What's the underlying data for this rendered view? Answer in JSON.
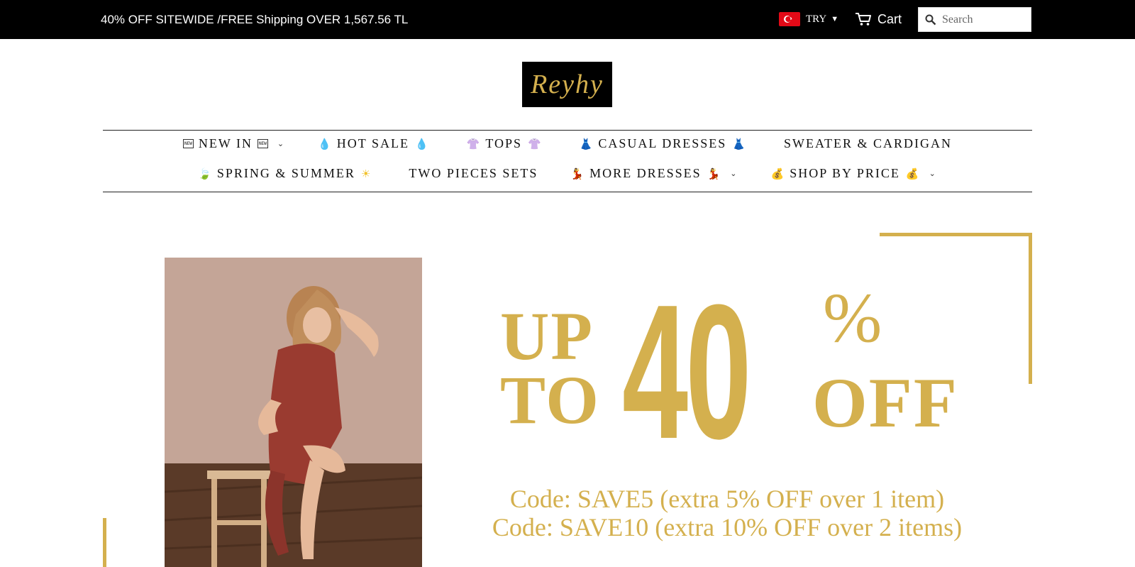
{
  "topbar": {
    "announcement": "40% OFF SITEWIDE /FREE Shipping OVER 1,567.56 TL",
    "currency": {
      "code": "TRY",
      "flag_icon": "turkey-flag-icon"
    },
    "cart_label": "Cart",
    "search_placeholder": "Search"
  },
  "logo": {
    "text": "Reyhy"
  },
  "nav": {
    "row1": [
      {
        "label": "NEW IN",
        "icon": "new-badge-icon",
        "icon_text": "NEW",
        "dropdown": true
      },
      {
        "label": "HOT SALE",
        "icon": "fire-icon",
        "icon_glyph": "💧",
        "dropdown": false
      },
      {
        "label": "TOPS",
        "icon": "tshirt-icon",
        "icon_glyph": "👚",
        "dropdown": false
      },
      {
        "label": "CASUAL DRESSES",
        "icon": "dress-icon",
        "icon_glyph": "👗",
        "dropdown": false
      },
      {
        "label": "SWEATER & CARDIGAN",
        "icon": null,
        "dropdown": false
      }
    ],
    "row2": [
      {
        "label": "SPRING & SUMMER",
        "icon_left": "leaf-icon",
        "icon_left_glyph": "🍃",
        "icon_right": "sun-icon",
        "icon_right_glyph": "☀",
        "dropdown": false
      },
      {
        "label": "TWO PIECES SETS",
        "dropdown": false
      },
      {
        "label": "MORE DRESSES",
        "icon": "dancer-icon",
        "icon_glyph": "💃",
        "dropdown": true
      },
      {
        "label": "SHOP BY PRICE",
        "icon": "money-bag-icon",
        "icon_glyph": "💰",
        "dropdown": true
      }
    ]
  },
  "hero": {
    "promo_up": "UP",
    "promo_to": "TO",
    "promo_number": "40",
    "promo_percent": "%",
    "promo_off": "OFF",
    "code_line1": "Code: SAVE5 (extra 5% OFF over 1 item)",
    "code_line2": "Code: SAVE10 (extra 10% OFF over 2 items)"
  },
  "colors": {
    "gold": "#d4b04e",
    "topbar_bg": "#000000"
  }
}
